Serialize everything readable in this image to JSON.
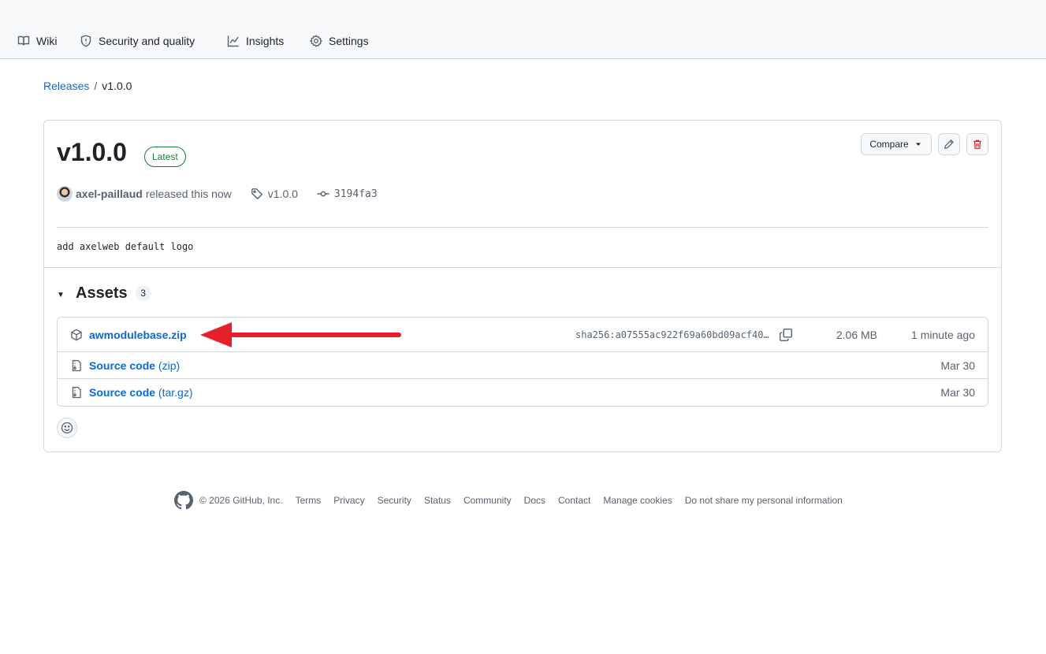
{
  "nav": {
    "items": [
      {
        "label": "Wiki",
        "icon": "book-icon"
      },
      {
        "label": "Security and quality",
        "icon": "shield-icon"
      },
      {
        "label": "Insights",
        "icon": "graph-icon"
      },
      {
        "label": "Settings",
        "icon": "gear-icon"
      }
    ]
  },
  "breadcrumb": {
    "parent": "Releases",
    "separator": "/",
    "current": "v1.0.0"
  },
  "release": {
    "title": "v1.0.0",
    "badge": "Latest",
    "compare_label": "Compare",
    "author": "axel-paillaud",
    "released_text": "released this now",
    "tag": "v1.0.0",
    "commit": "3194fa3",
    "body": "add axelweb default logo"
  },
  "assets": {
    "title": "Assets",
    "count": "3",
    "items": [
      {
        "name": "awmodulebase.zip",
        "ext": "",
        "sha": "sha256:a07555ac922f69a60bd09acf40…",
        "size": "2.06 MB",
        "date": "1 minute ago"
      },
      {
        "name": "Source code",
        "ext": "(zip)",
        "sha": "",
        "size": "",
        "date": "Mar 30"
      },
      {
        "name": "Source code",
        "ext": "(tar.gz)",
        "sha": "",
        "size": "",
        "date": "Mar 30"
      }
    ]
  },
  "annotation": {
    "arrow_color": "#e5202a"
  },
  "footer": {
    "copyright": "© 2026 GitHub, Inc.",
    "links": [
      "Terms",
      "Privacy",
      "Security",
      "Status",
      "Community",
      "Docs",
      "Contact",
      "Manage cookies",
      "Do not share my personal information"
    ]
  }
}
